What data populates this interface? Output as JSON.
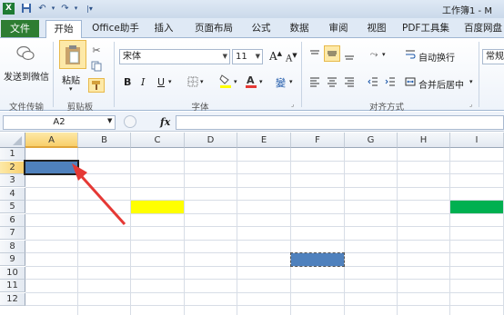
{
  "window": {
    "title": "工作簿1 - M"
  },
  "quick_access": {
    "icons": [
      "excel-icon",
      "save-icon",
      "undo-icon",
      "redo-icon",
      "customize-icon"
    ]
  },
  "tabs": [
    {
      "label": "文件"
    },
    {
      "label": "开始"
    },
    {
      "label": "Office助手"
    },
    {
      "label": "插入"
    },
    {
      "label": "页面布局"
    },
    {
      "label": "公式"
    },
    {
      "label": "数据"
    },
    {
      "label": "审阅"
    },
    {
      "label": "视图"
    },
    {
      "label": "PDF工具集"
    },
    {
      "label": "百度网盘"
    }
  ],
  "ribbon": {
    "wechat": {
      "label": "发送到微信",
      "group": "文件传输"
    },
    "clipboard": {
      "paste": "粘贴",
      "group": "剪贴板"
    },
    "font": {
      "name": "宋体",
      "size": "11",
      "group": "字体",
      "bold": "B",
      "italic": "I",
      "underline": "U",
      "grow": "A",
      "shrink": "A",
      "phonetic": "變"
    },
    "alignment": {
      "wrap": "自动换行",
      "merge": "合并后居中",
      "group": "对齐方式"
    },
    "number": {
      "format": "常规"
    }
  },
  "formula_bar": {
    "name_box": "A2",
    "fx": "fx",
    "value": ""
  },
  "grid": {
    "columns": [
      "A",
      "B",
      "C",
      "D",
      "E",
      "F",
      "G",
      "H",
      "I"
    ],
    "rows": [
      "1",
      "2",
      "3",
      "4",
      "5",
      "6",
      "7",
      "8",
      "9",
      "10",
      "11",
      "12"
    ],
    "selected_column": "A",
    "selected_row": "2",
    "filled_cells": [
      {
        "cell": "A2",
        "color": "#4f81bd"
      },
      {
        "cell": "C5",
        "color": "#ffff00"
      },
      {
        "cell": "I5",
        "color": "#00b050"
      },
      {
        "cell": "F9",
        "color": "#4f81bd"
      }
    ],
    "annotation_color": "#e53935"
  }
}
